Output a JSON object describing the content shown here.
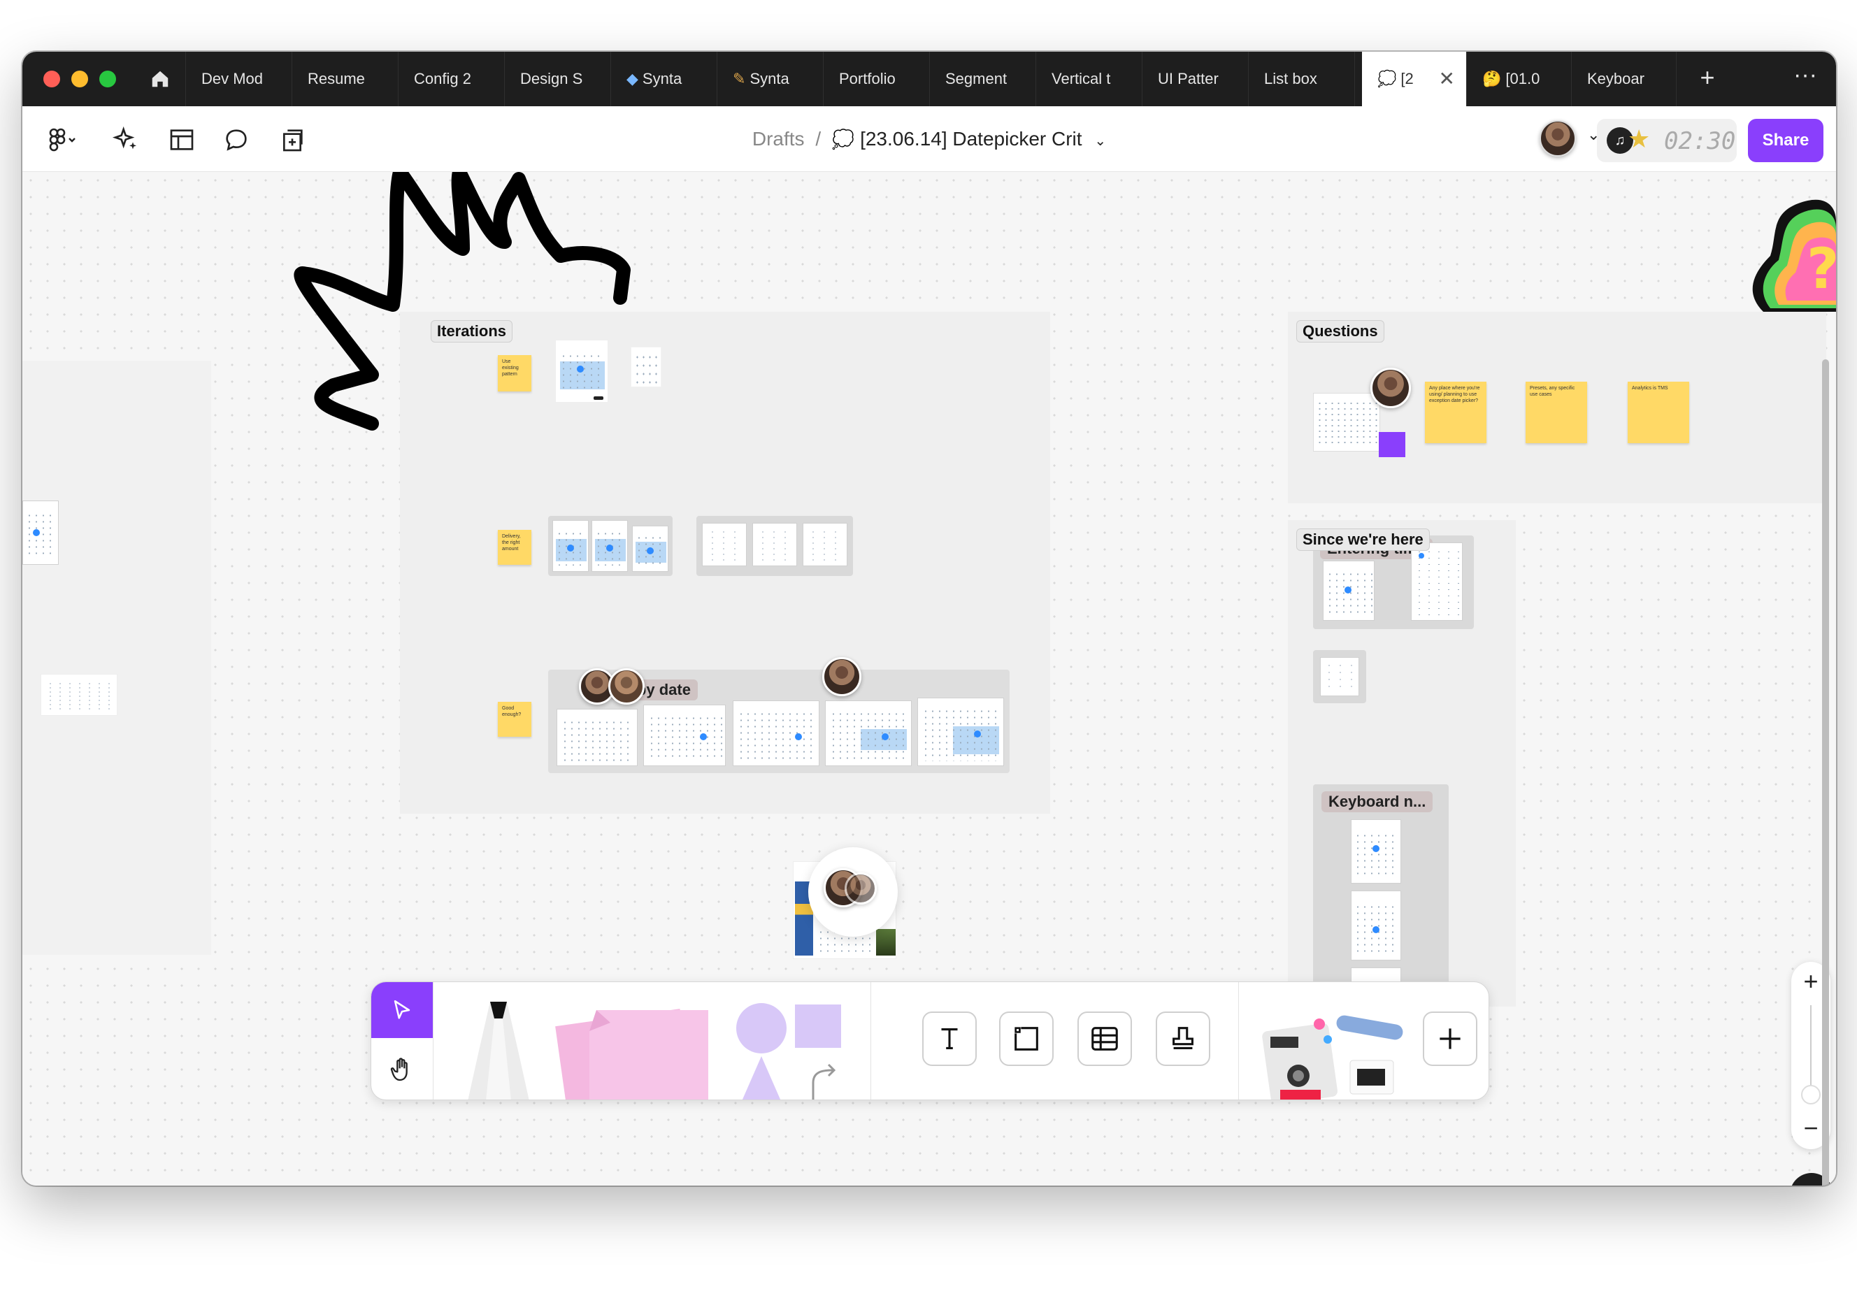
{
  "tabs": [
    {
      "label": "Dev Mod"
    },
    {
      "label": "Resume"
    },
    {
      "label": "Config 2"
    },
    {
      "label": "Design S"
    },
    {
      "label": "Synta"
    },
    {
      "label": "Synta"
    },
    {
      "label": "Portfolio"
    },
    {
      "label": "Segment"
    },
    {
      "label": "Vertical t"
    },
    {
      "label": "UI Patter"
    },
    {
      "label": "List box"
    },
    {
      "label": "[2"
    },
    {
      "label": "[01.0"
    },
    {
      "label": "Keyboar"
    }
  ],
  "toolbar": {
    "breadcrumb_root": "Drafts",
    "breadcrumb_sep": "/",
    "file_title": "[23.06.14] Datepicker Crit",
    "timer": "02:30",
    "share_label": "Share"
  },
  "canvas": {
    "sections": {
      "iterations": "Iterations",
      "questions": "Questions",
      "since_here": "Since we're here",
      "entering_time": "Entering time",
      "filters_by_date": "rs by date",
      "keyboard_nav": "Keyboard n..."
    },
    "stickies": {
      "use_existing": "Use existing pattern",
      "delivery": "Delivery, the right amount",
      "good_enough": "Good enough?",
      "q1": "Any place where you're using/ planning to use exception date picker?",
      "q2": "Presets, any specific use cases",
      "q3": "Analytics is TMS"
    }
  },
  "zoom": {
    "plus": "+",
    "minus": "−"
  },
  "help_label": "?",
  "colors": {
    "accent": "#8a3ffc",
    "sticky": "#ffd966",
    "tabbar": "#1e1e1e"
  }
}
